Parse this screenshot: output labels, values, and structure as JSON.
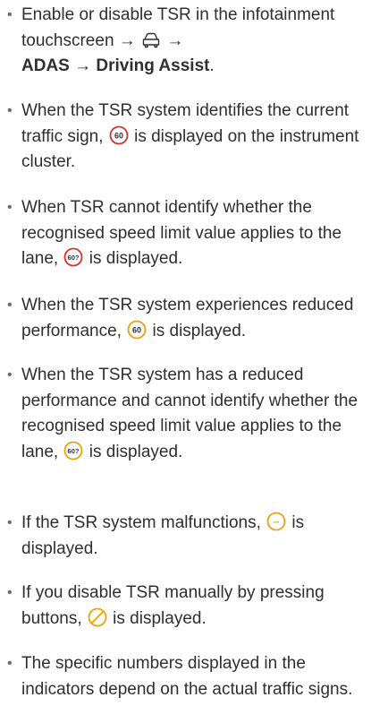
{
  "bullet_char": "•",
  "colors": {
    "text": "#2f2f2f",
    "sign_red": "#d0342c",
    "sign_amber": "#e8a20c"
  },
  "items": [
    {
      "t1": "Enable or disable TSR in the infotainment touchscreen → ",
      "icon": "car-icon",
      "t2": " →",
      "b1": "ADAS",
      "t3": " → ",
      "b2": "Driving Assist",
      "t4": "."
    },
    {
      "t1": "When the TSR system identifies the current traffic sign, ",
      "icon": "speed-limit-red-icon",
      "icon_text": "60",
      "t2": " is displayed on the instrument cluster."
    },
    {
      "t1": "When TSR cannot identify whether the recognised speed limit value applies to the lane, ",
      "icon": "speed-limit-uncertain-red-icon",
      "icon_text": "60?",
      "t2": " is displayed."
    },
    {
      "t1": "When the TSR system experiences reduced performance, ",
      "icon": "speed-limit-amber-icon",
      "icon_text": "60",
      "t2": " is displayed."
    },
    {
      "t1": "When the TSR system has a reduced performance and cannot identify whether the recognised speed limit value applies to the lane, ",
      "icon": "speed-limit-uncertain-amber-icon",
      "icon_text": "60?",
      "t2": " is displayed."
    },
    {
      "t1": "If the TSR system malfunctions, ",
      "icon": "tsr-malfunction-icon",
      "icon_text": "--",
      "t2": " is displayed."
    },
    {
      "t1": "If you disable TSR manually by pressing buttons, ",
      "icon": "tsr-disabled-icon",
      "t2": " is displayed."
    },
    {
      "t1": "The specific numbers displayed in the indicators depend on the actual traffic signs."
    }
  ]
}
